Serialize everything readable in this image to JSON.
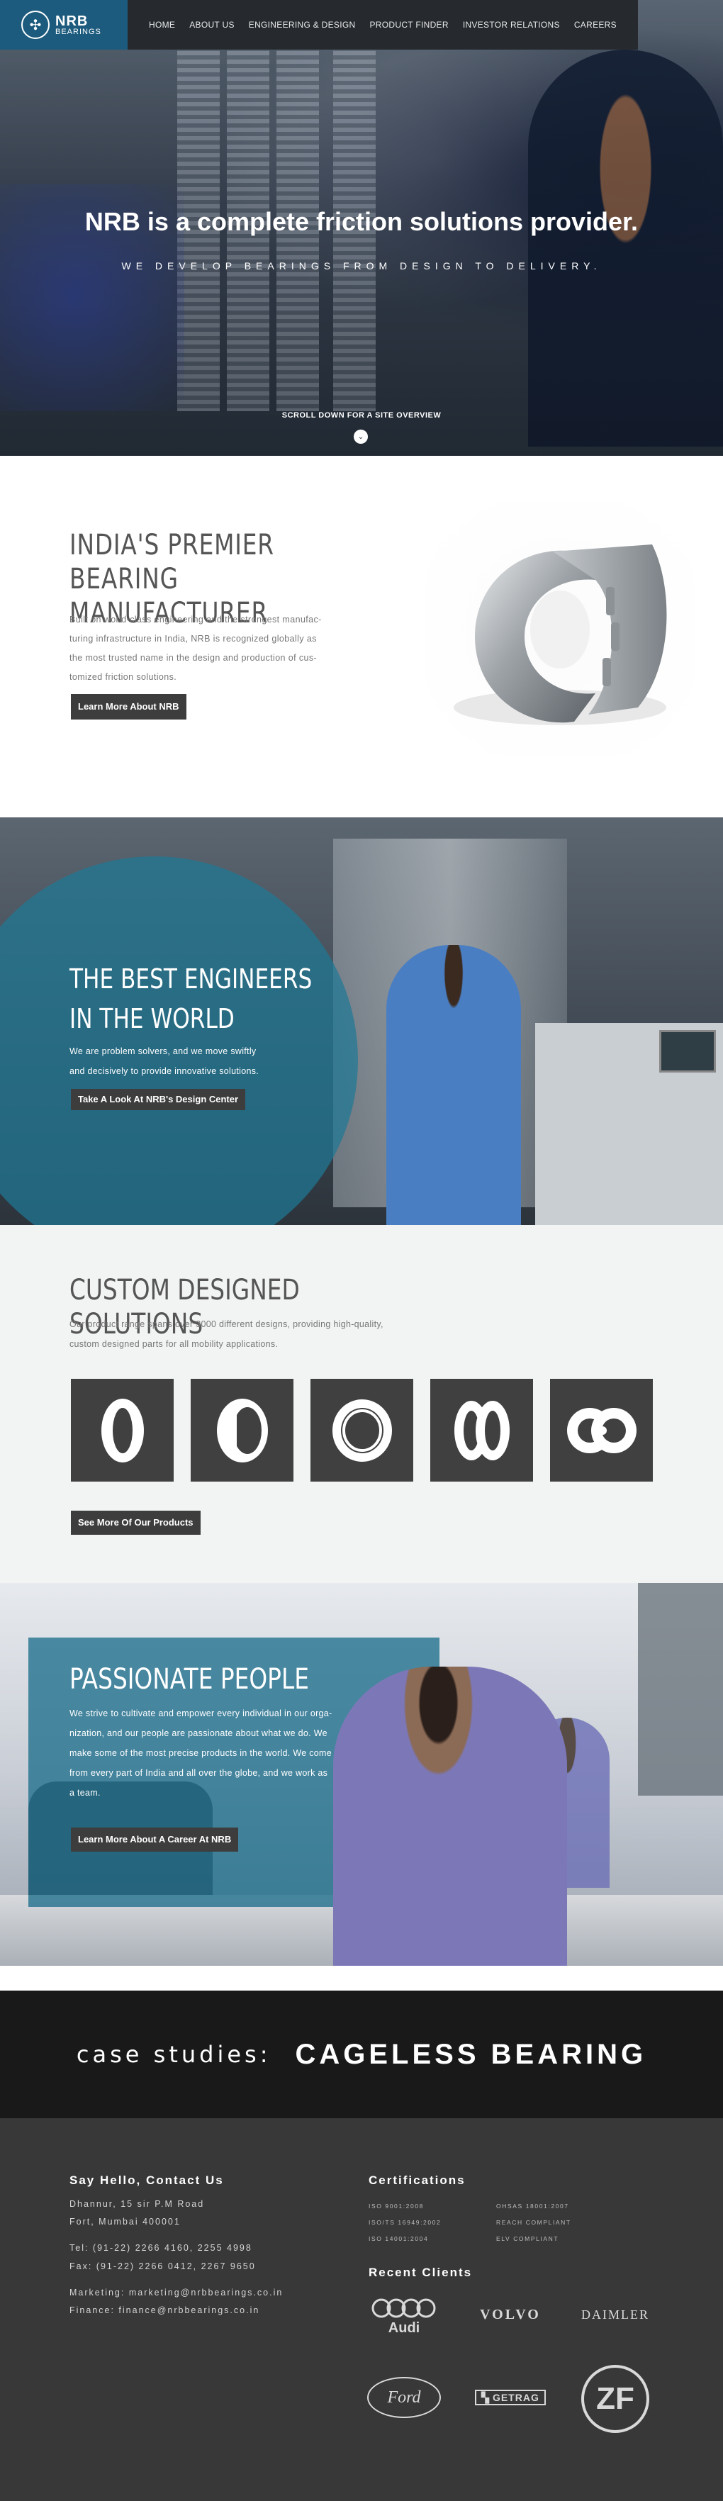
{
  "brand": {
    "name": "NRB",
    "sub": "BEARINGS"
  },
  "nav": [
    "HOME",
    "ABOUT US",
    "ENGINEERING & DESIGN",
    "PRODUCT FINDER",
    "INVESTOR RELATIONS",
    "CAREERS"
  ],
  "hero": {
    "title": "NRB is a complete friction solutions provider.",
    "subtitle": "WE DEVELOP BEARINGS FROM DESIGN TO DELIVERY.",
    "scroll": "SCROLL DOWN FOR A SITE OVERVIEW",
    "scroll_icon": "chevron-down-icon"
  },
  "premier": {
    "title_line1": "INDIA'S PREMIER",
    "title_line2": "BEARING MANUFACTURER",
    "line1": "Built on world-class engineering and the strongest manufac-",
    "line2": "turing infrastructure in India, NRB is recognized globally as",
    "line3": "the most trusted name in the design and production of cus-",
    "line4": "tomized friction solutions.",
    "button": "Learn More About NRB"
  },
  "engineers": {
    "title_line1": "THE BEST ENGINEERS",
    "title_line2": "IN THE WORLD",
    "line1": "We are problem solvers, and we move swiftly",
    "line2": "and decisively to provide innovative solutions.",
    "button": "Take A Look At NRB's Design Center"
  },
  "custom": {
    "title": "CUSTOM DESIGNED SOLUTIONS",
    "line1": "Our product range spans over 3000 different designs, providing high-quality,",
    "line2": "custom designed parts for all mobility applications.",
    "products": [
      "ring-bearing-icon",
      "needle-cage-icon",
      "roller-bearing-icon",
      "double-ring-icon",
      "double-roller-icon"
    ],
    "button": "See More Of Our Products"
  },
  "people": {
    "title": "PASSIONATE PEOPLE",
    "line1": "We strive to cultivate and empower every individual in our orga-",
    "line2": "nization, and our people are passionate about what we do. We",
    "line3": "make some of the most precise products in the world. We come",
    "line4": "from every part of India and all over the globe, and we work as",
    "line5": "a team.",
    "button": "Learn More About A Career At NRB"
  },
  "case": {
    "label": "case studies:",
    "title": "CAGELESS BEARING"
  },
  "footer": {
    "contact_title": "Say Hello, Contact Us",
    "addr1": "Dhannur, 15 sir P.M Road",
    "addr2": "Fort, Mumbai 400001",
    "tel": "Tel: (91-22) 2266 4160, 2255 4998",
    "fax": "Fax: (91-22) 2266 0412, 2267 9650",
    "marketing": "Marketing: marketing@nrbbearings.co.in",
    "finance": "Finance: finance@nrbbearings.co.in",
    "cert_title": "Certifications",
    "certs": [
      "ISO 9001:2008",
      "OHSAS 18001:2007",
      "ISO/TS 16949:2002",
      "REACH COMPLIANT",
      "ISO 14001:2004",
      "ELV COMPLIANT"
    ],
    "clients_title": "Recent Clients",
    "clients": [
      "Audi",
      "VOLVO",
      "DAIMLER",
      "Ford",
      "GETRAG",
      "ZF"
    ]
  },
  "colors": {
    "brand_blue": "#1c5b7d",
    "nav_dark": "#262a2f",
    "teal_overlay": "#1e788f",
    "button_dark": "#3d3d3d",
    "footer_bg": "#383838"
  }
}
